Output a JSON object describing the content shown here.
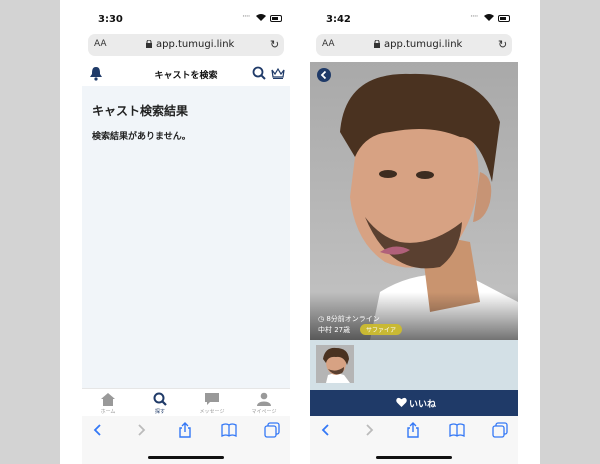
{
  "left": {
    "status_time": "3:30",
    "url_aa": "AA",
    "url": "app.tumugi.link",
    "header_title": "キャストを検索",
    "result_heading": "キャスト検索結果",
    "result_message": "検索結果がありません。",
    "tabs": [
      {
        "label": "ホーム",
        "icon": "home-icon"
      },
      {
        "label": "探す",
        "icon": "search-icon"
      },
      {
        "label": "メッセージ",
        "icon": "message-icon"
      },
      {
        "label": "マイページ",
        "icon": "person-icon"
      }
    ],
    "active_tab": 1
  },
  "right": {
    "status_time": "3:42",
    "url_aa": "AA",
    "url": "app.tumugi.link",
    "online_text": "8分前オンライン",
    "name_age": "中村 27歳",
    "badge": "サファイア",
    "like_label": "いいね"
  },
  "colors": {
    "navy": "#1f3a68",
    "content_bg": "#f1f5f9",
    "strip_bg": "#d3e0e6",
    "badge": "#c9b933"
  }
}
